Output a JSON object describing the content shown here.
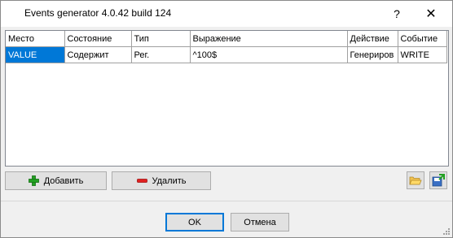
{
  "window": {
    "title": "Events generator 4.0.42 build 124",
    "help_glyph": "?",
    "close_glyph": "✕"
  },
  "grid": {
    "columns": [
      "Место",
      "Состояние",
      "Тип",
      "Выражение",
      "Действие",
      "Событие"
    ],
    "rows": [
      [
        "VALUE",
        "Содержит",
        "Рег.",
        "^100$",
        "Генериров",
        "WRITE"
      ]
    ]
  },
  "buttons": {
    "add_label": "Добавить",
    "delete_label": "Удалить",
    "ok_label": "OK",
    "cancel_label": "Отмена"
  },
  "icons": {
    "add": "plus-icon",
    "delete": "minus-icon",
    "open": "folder-open-icon",
    "save": "save-icon"
  },
  "colors": {
    "selection": "#0078d7",
    "add_icon": "#22a022",
    "delete_icon": "#e02020"
  }
}
